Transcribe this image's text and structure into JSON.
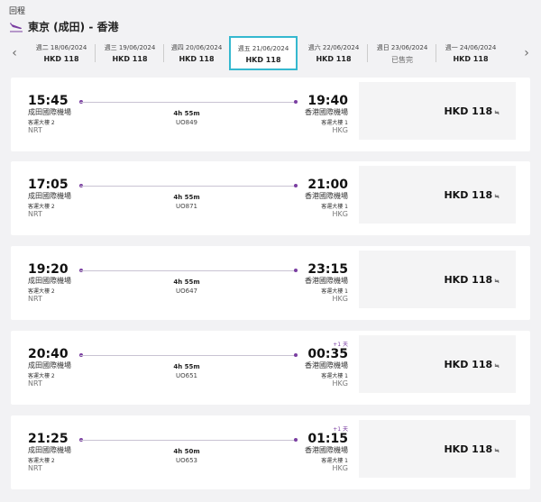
{
  "header": {
    "label": "回程",
    "route": "東京 (成田) - 香港"
  },
  "datebar": {
    "tabs": [
      {
        "date": "週二 18/06/2024",
        "price": "HKD 118"
      },
      {
        "date": "週三 19/06/2024",
        "price": "HKD 118"
      },
      {
        "date": "週四 20/06/2024",
        "price": "HKD 118"
      },
      {
        "date": "週五 21/06/2024",
        "price": "HKD 118",
        "active": true
      },
      {
        "date": "週六 22/06/2024",
        "price": "HKD 118"
      },
      {
        "date": "週日 23/06/2024",
        "price": "已售完"
      },
      {
        "date": "週一 24/06/2024",
        "price": "HKD 118"
      }
    ],
    "prev": "‹",
    "next": "›"
  },
  "flights": [
    {
      "dep_time": "15:45",
      "dep_airport": "成田國際機場",
      "dep_terminal": "客運大樓 2",
      "dep_code": "NRT",
      "duration": "4h 55m",
      "flight_no": "UO849",
      "arr_time": "19:40",
      "arr_airport": "香港國際機場",
      "arr_terminal": "客運大樓 1",
      "arr_code": "HKG",
      "plus_day": "",
      "price": "HKD 118",
      "price_symbol": "≒"
    },
    {
      "dep_time": "17:05",
      "dep_airport": "成田國際機場",
      "dep_terminal": "客運大樓 2",
      "dep_code": "NRT",
      "duration": "4h 55m",
      "flight_no": "UO871",
      "arr_time": "21:00",
      "arr_airport": "香港國際機場",
      "arr_terminal": "客運大樓 1",
      "arr_code": "HKG",
      "plus_day": "",
      "price": "HKD 118",
      "price_symbol": "≒"
    },
    {
      "dep_time": "19:20",
      "dep_airport": "成田國際機場",
      "dep_terminal": "客運大樓 2",
      "dep_code": "NRT",
      "duration": "4h 55m",
      "flight_no": "UO647",
      "arr_time": "23:15",
      "arr_airport": "香港國際機場",
      "arr_terminal": "客運大樓 1",
      "arr_code": "HKG",
      "plus_day": "",
      "price": "HKD 118",
      "price_symbol": "≒"
    },
    {
      "dep_time": "20:40",
      "dep_airport": "成田國際機場",
      "dep_terminal": "客運大樓 2",
      "dep_code": "NRT",
      "duration": "4h 55m",
      "flight_no": "UO651",
      "arr_time": "00:35",
      "arr_airport": "香港國際機場",
      "arr_terminal": "客運大樓 1",
      "arr_code": "HKG",
      "plus_day": "+1 天",
      "price": "HKD 118",
      "price_symbol": "≒"
    },
    {
      "dep_time": "21:25",
      "dep_airport": "成田國際機場",
      "dep_terminal": "客運大樓 2",
      "dep_code": "NRT",
      "duration": "4h 50m",
      "flight_no": "UO653",
      "arr_time": "01:15",
      "arr_airport": "香港國際機場",
      "arr_terminal": "客運大樓 1",
      "arr_code": "HKG",
      "plus_day": "+1 天",
      "price": "HKD 118",
      "price_symbol": "≒"
    }
  ],
  "colors": {
    "accent": "#7a3ea1",
    "active_tab_border": "#35b8cf"
  }
}
